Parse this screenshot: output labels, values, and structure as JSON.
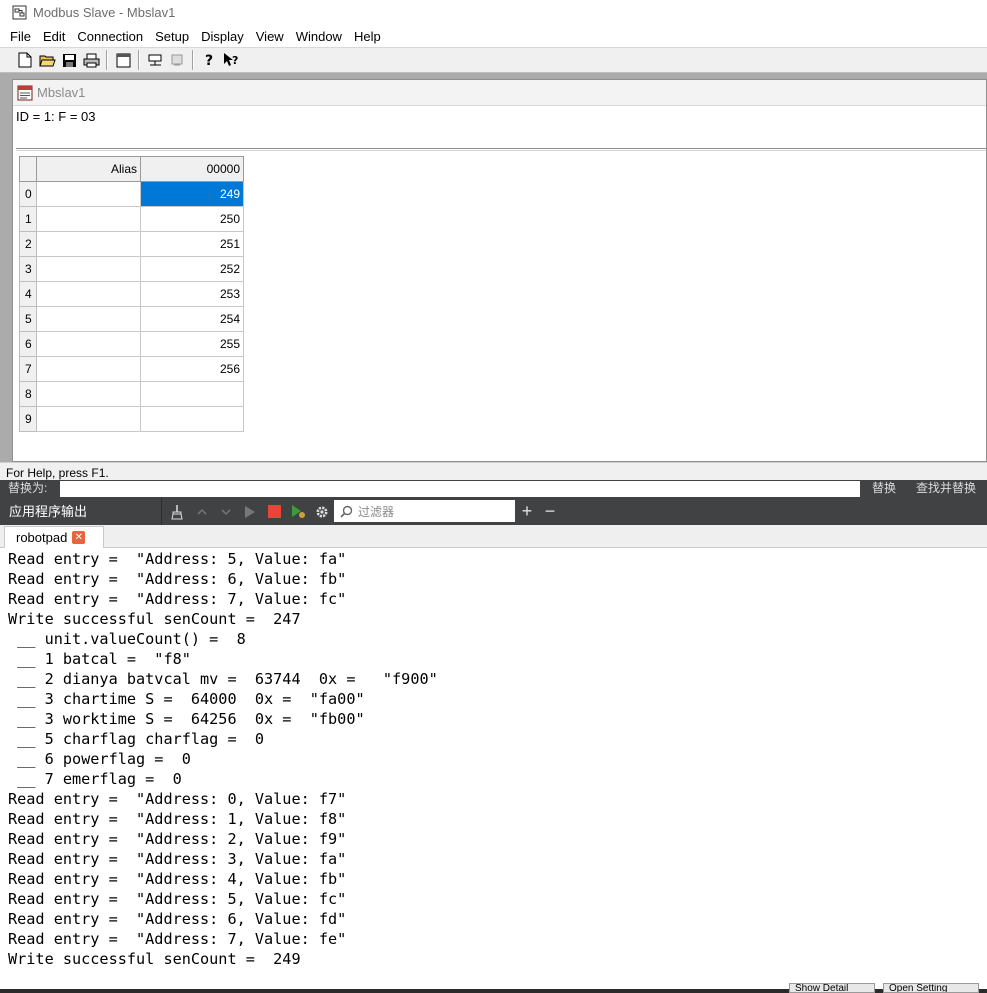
{
  "window": {
    "title": "Modbus Slave - Mbslav1"
  },
  "menu": [
    "File",
    "Edit",
    "Connection",
    "Setup",
    "Display",
    "View",
    "Window",
    "Help"
  ],
  "child": {
    "title": "Mbslav1",
    "info": "ID = 1: F = 03",
    "grid": {
      "header_alias": "Alias",
      "header_col": "00000",
      "rows": [
        {
          "idx": "0",
          "alias": "",
          "value": "249"
        },
        {
          "idx": "1",
          "alias": "",
          "value": "250"
        },
        {
          "idx": "2",
          "alias": "",
          "value": "251"
        },
        {
          "idx": "3",
          "alias": "",
          "value": "252"
        },
        {
          "idx": "4",
          "alias": "",
          "value": "253"
        },
        {
          "idx": "5",
          "alias": "",
          "value": "254"
        },
        {
          "idx": "6",
          "alias": "",
          "value": "255"
        },
        {
          "idx": "7",
          "alias": "",
          "value": "256"
        },
        {
          "idx": "8",
          "alias": "",
          "value": ""
        },
        {
          "idx": "9",
          "alias": "",
          "value": ""
        }
      ]
    }
  },
  "status": {
    "text": "For Help, press F1."
  },
  "replace_bar": {
    "label": "替换为:",
    "replace": "替换",
    "find_replace": "查找并替换"
  },
  "output_pane": {
    "title": "应用程序输出",
    "filter_placeholder": "过滤器",
    "tab": "robotpad",
    "lines": [
      "Read entry =  \"Address: 5, Value: fa\"",
      "Read entry =  \"Address: 6, Value: fb\"",
      "Read entry =  \"Address: 7, Value: fc\"",
      "Write successful senCount =  247",
      " __ unit.valueCount() =  8",
      " __ 1 batcal =  \"f8\"",
      " __ 2 dianya batvcal mv =  63744  0x =   \"f900\"",
      " __ 3 chartime S =  64000  0x =  \"fa00\"",
      " __ 3 worktime S =  64256  0x =  \"fb00\"",
      " __ 5 charflag charflag =  0",
      " __ 6 powerflag =  0",
      " __ 7 emerflag =  0",
      "Read entry =  \"Address: 0, Value: f7\"",
      "Read entry =  \"Address: 1, Value: f8\"",
      "Read entry =  \"Address: 2, Value: f9\"",
      "Read entry =  \"Address: 3, Value: fa\"",
      "Read entry =  \"Address: 4, Value: fb\"",
      "Read entry =  \"Address: 5, Value: fc\"",
      "Read entry =  \"Address: 6, Value: fd\"",
      "Read entry =  \"Address: 7, Value: fe\"",
      "Write successful senCount =  249"
    ]
  },
  "bottom_buttons": [
    "Show Detail",
    "Open Setting"
  ],
  "colors": {
    "selection": "#0078d7",
    "pane_dark": "#404244",
    "stop_red": "#e8443a",
    "run_green": "#3c9b3c"
  }
}
